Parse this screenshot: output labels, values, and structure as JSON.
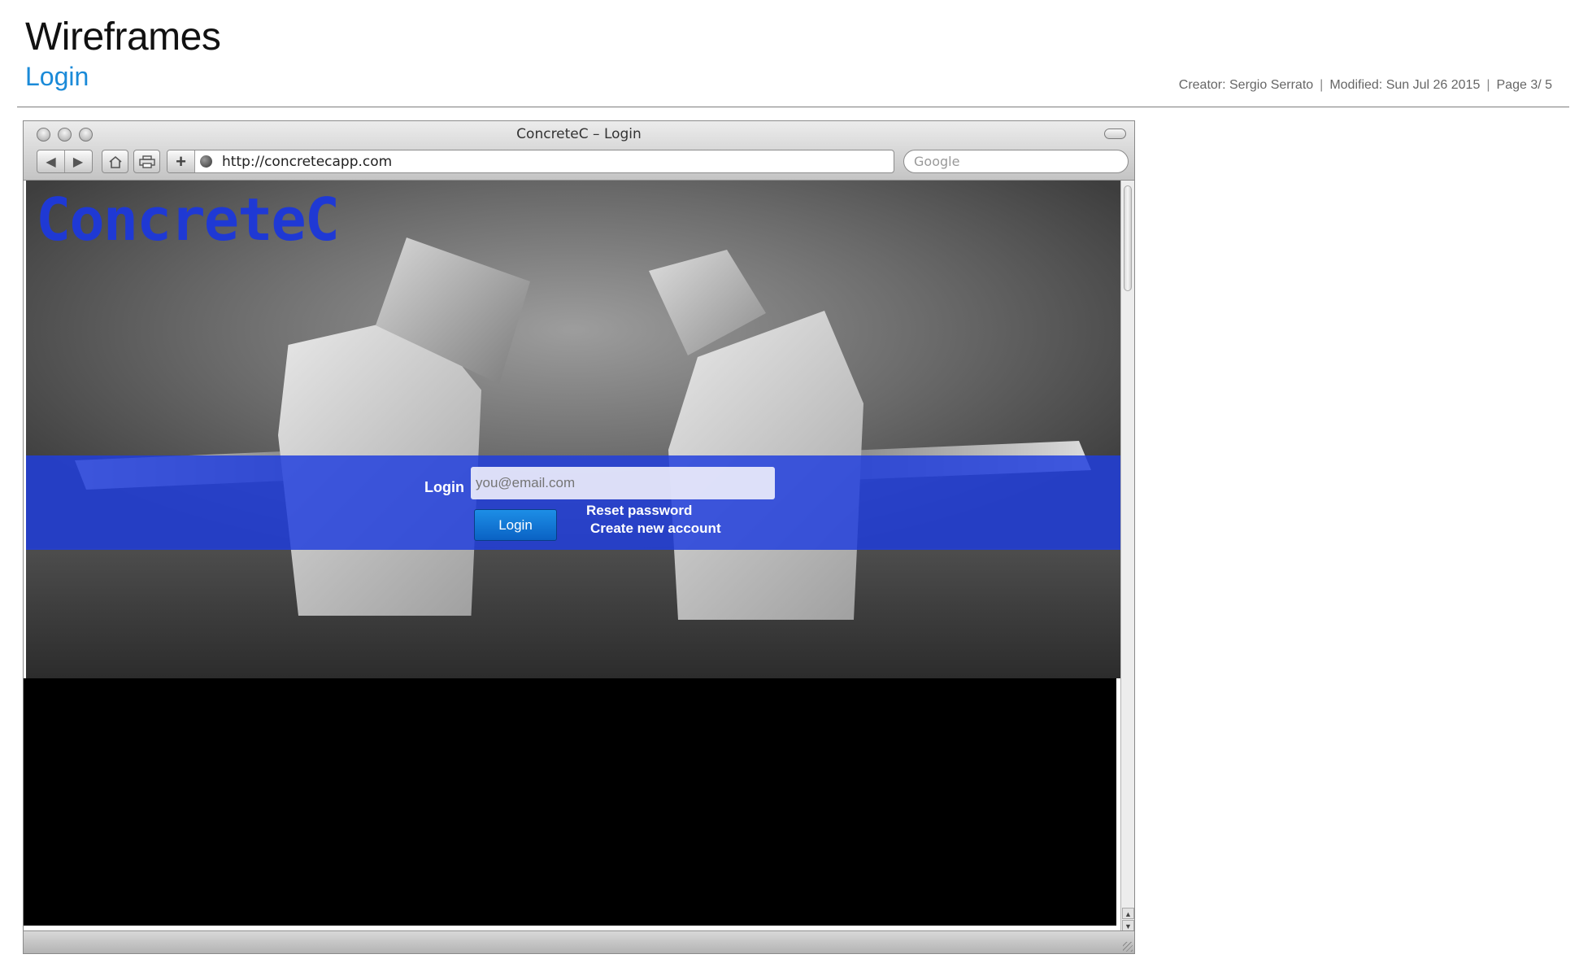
{
  "document": {
    "title": "Wireframes",
    "subtitle": "Login",
    "creator": "Creator: Sergio Serrato",
    "modified": "Modified: Sun Jul 26 2015",
    "page": "Page 3/ 5",
    "separator": "|"
  },
  "browser": {
    "window_title": "ConcreteC – Login",
    "url": "http://concretecapp.com",
    "search_placeholder": "Google",
    "icons": {
      "back": "back-arrow-icon",
      "forward": "forward-arrow-icon",
      "home": "home-icon",
      "print": "print-icon",
      "add": "plus-icon",
      "site": "globe-icon"
    }
  },
  "app": {
    "logo": "ConcreteC",
    "login_label": "Login",
    "email_placeholder": "you@email.com",
    "login_button": "Login",
    "reset_password": "Reset password",
    "create_account": "Create new account"
  },
  "colors": {
    "accent_blue": "#1a8ad8",
    "logo_blue": "#1f39d4",
    "band_blue": "#203ede",
    "button_blue": "#0a62c4"
  }
}
